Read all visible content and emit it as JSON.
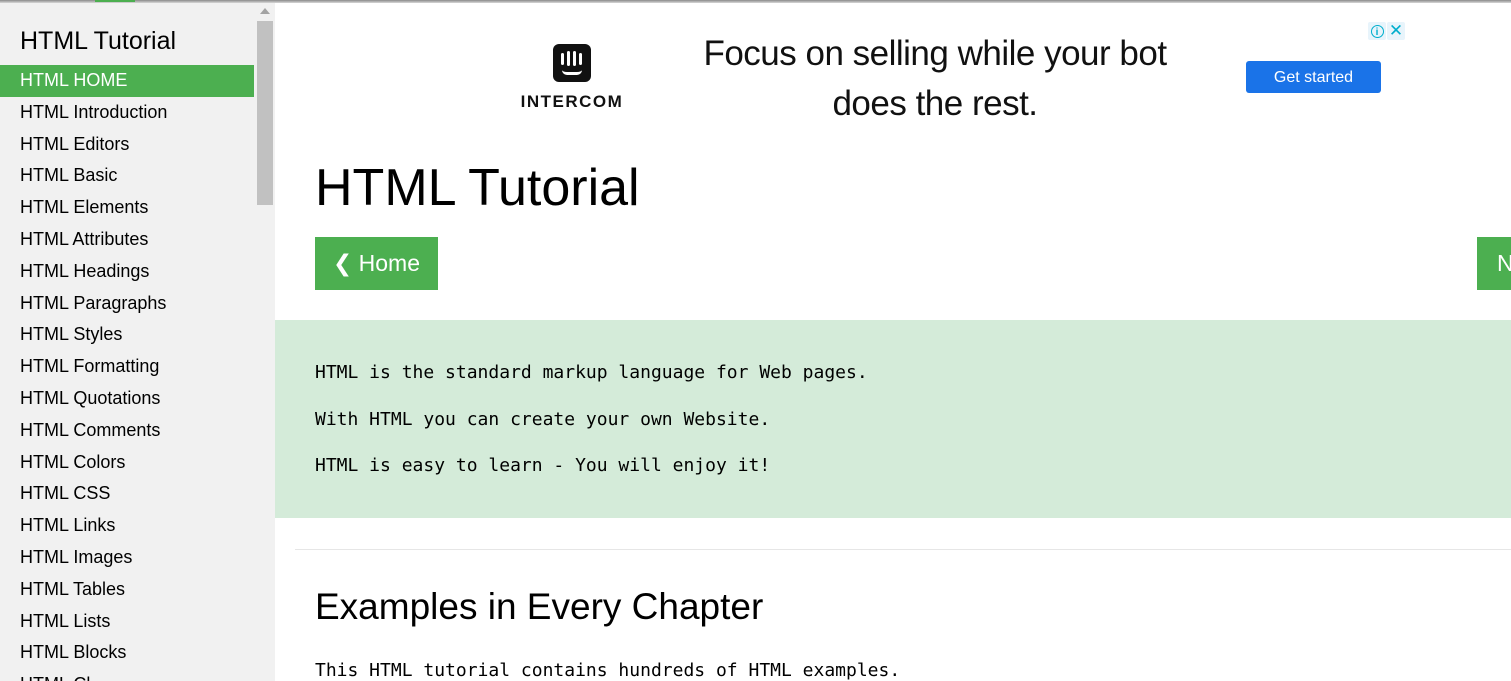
{
  "sidebar": {
    "title": "HTML Tutorial",
    "items": [
      {
        "label": "HTML HOME",
        "active": true
      },
      {
        "label": "HTML Introduction"
      },
      {
        "label": "HTML Editors"
      },
      {
        "label": "HTML Basic"
      },
      {
        "label": "HTML Elements"
      },
      {
        "label": "HTML Attributes"
      },
      {
        "label": "HTML Headings"
      },
      {
        "label": "HTML Paragraphs"
      },
      {
        "label": "HTML Styles"
      },
      {
        "label": "HTML Formatting"
      },
      {
        "label": "HTML Quotations"
      },
      {
        "label": "HTML Comments"
      },
      {
        "label": "HTML Colors"
      },
      {
        "label": "HTML CSS"
      },
      {
        "label": "HTML Links"
      },
      {
        "label": "HTML Images"
      },
      {
        "label": "HTML Tables"
      },
      {
        "label": "HTML Lists"
      },
      {
        "label": "HTML Blocks"
      },
      {
        "label": "HTML Cl"
      }
    ]
  },
  "ad": {
    "brand": "INTERCOM",
    "headline": "Focus on selling while your bot does the rest.",
    "cta_label": "Get started",
    "info_symbol": "i",
    "close_symbol": "✕"
  },
  "main": {
    "title": "HTML Tutorial",
    "prev_button": "❮ Home",
    "next_button": "N",
    "intro_lines": [
      "HTML is the standard markup language for Web pages.",
      "With HTML you can create your own Website.",
      "HTML is easy to learn - You will enjoy it!"
    ],
    "section_title": "Examples in Every Chapter",
    "section_text": "This HTML tutorial contains hundreds of HTML examples."
  },
  "colors": {
    "accent_green": "#4caf50",
    "panel_green": "#d4ebd9",
    "sidebar_bg": "#f1f1f1",
    "cta_blue": "#1a73e8"
  }
}
